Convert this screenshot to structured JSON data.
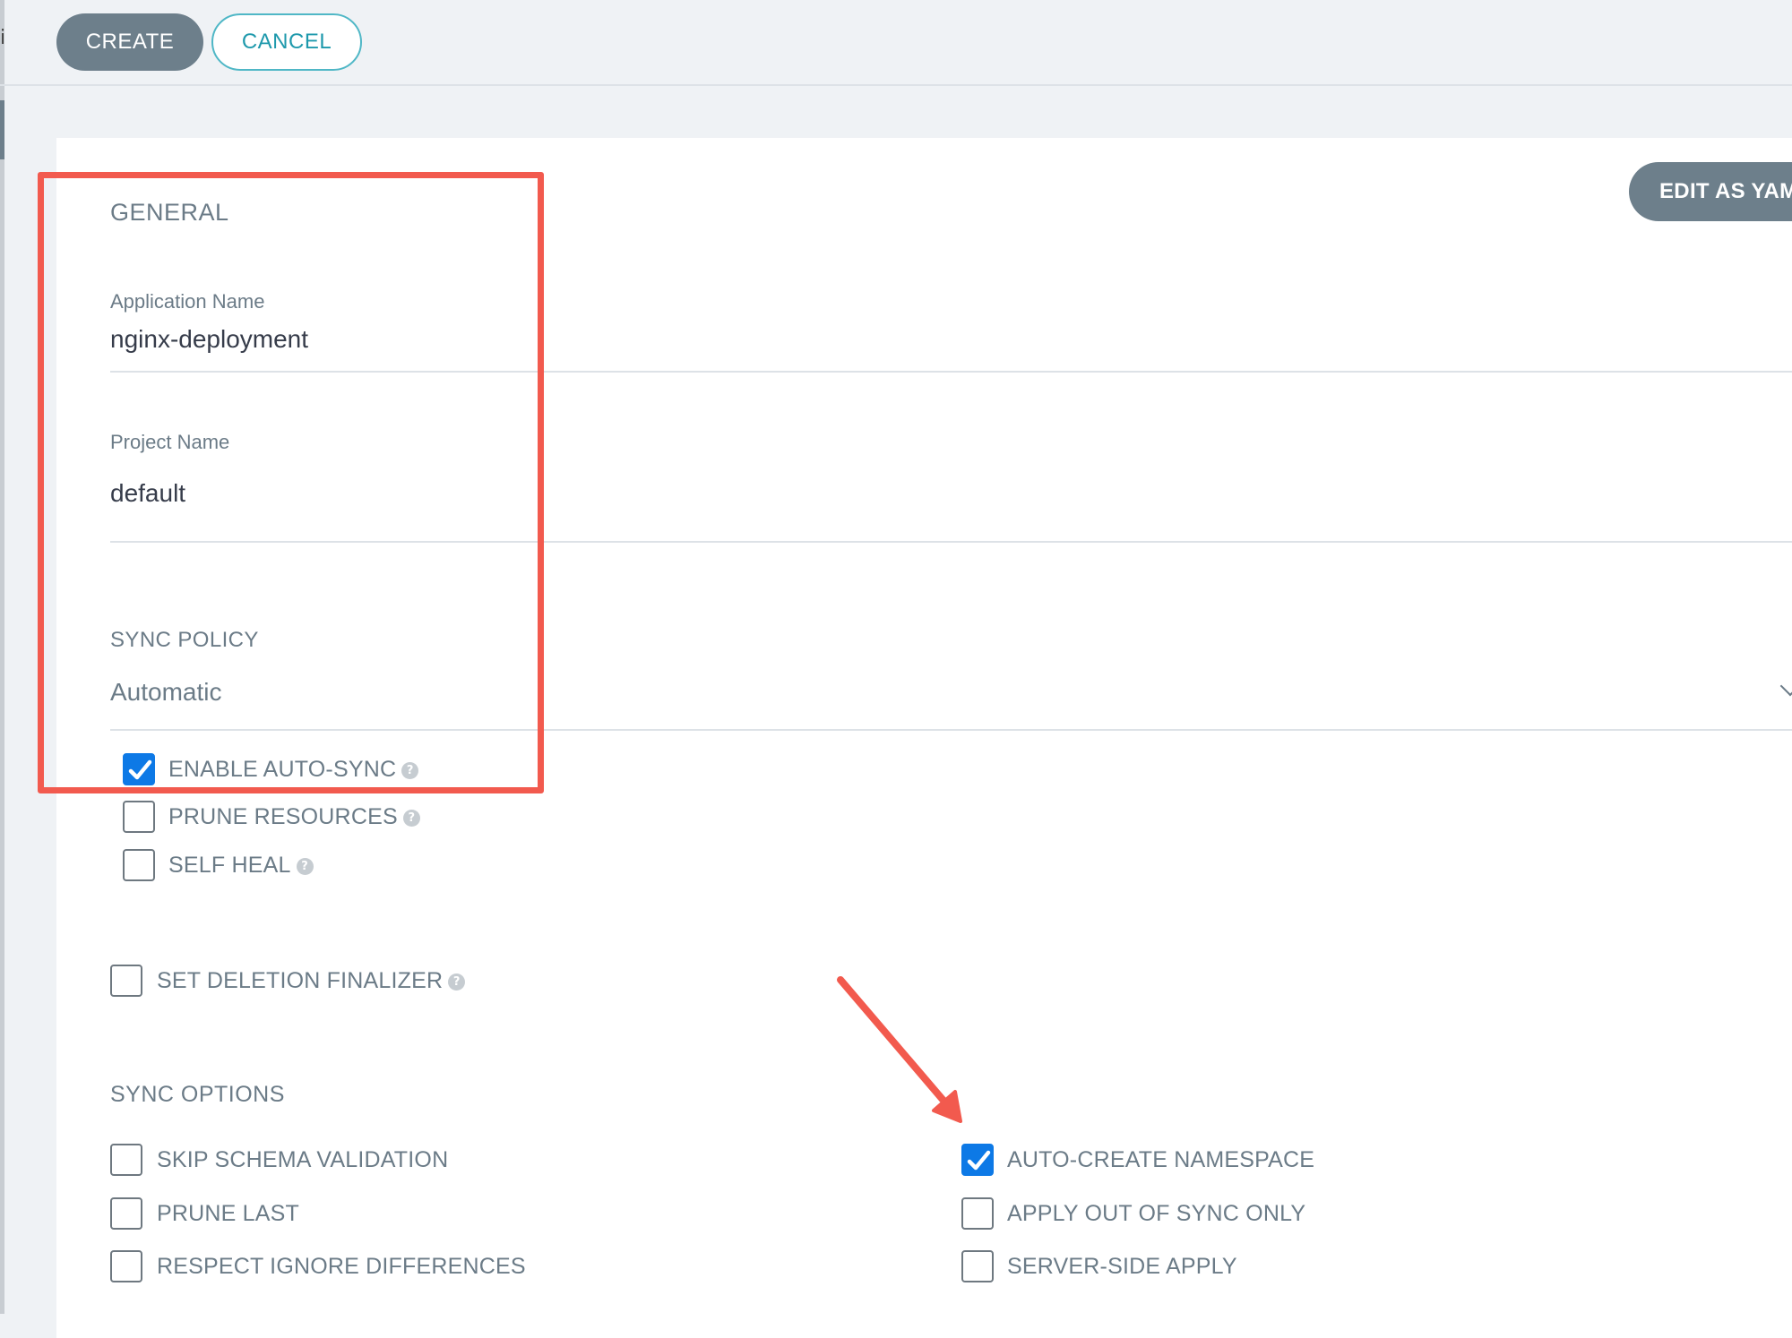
{
  "window": {
    "left_glyph": "i"
  },
  "toolbar": {
    "create_label": "CREATE",
    "cancel_label": "CANCEL"
  },
  "panel": {
    "edit_yaml_label": "EDIT AS YAM"
  },
  "general": {
    "title": "GENERAL",
    "application_name": {
      "label": "Application Name",
      "value": "nginx-deployment"
    },
    "project_name": {
      "label": "Project Name",
      "value": "default"
    }
  },
  "sync_policy": {
    "title": "SYNC POLICY",
    "selected": "Automatic",
    "options": [
      {
        "label": "ENABLE AUTO-SYNC",
        "checked": true
      },
      {
        "label": "PRUNE RESOURCES",
        "checked": false
      },
      {
        "label": "SELF HEAL",
        "checked": false
      }
    ]
  },
  "finalizer": {
    "label": "SET DELETION FINALIZER",
    "checked": false
  },
  "sync_options": {
    "title": "SYNC OPTIONS",
    "left": [
      {
        "label": "SKIP SCHEMA VALIDATION",
        "checked": false
      },
      {
        "label": "PRUNE LAST",
        "checked": false
      },
      {
        "label": "RESPECT IGNORE DIFFERENCES",
        "checked": false
      }
    ],
    "right": [
      {
        "label": "AUTO-CREATE NAMESPACE",
        "checked": true
      },
      {
        "label": "APPLY OUT OF SYNC ONLY",
        "checked": false
      },
      {
        "label": "SERVER-SIDE APPLY",
        "checked": false
      }
    ]
  },
  "help_glyph": "?",
  "colors": {
    "accent_check": "#0d79e6",
    "annotation": "#f25a4e",
    "button_gray": "#6d7f8b",
    "cancel_teal": "#1e99ac"
  }
}
